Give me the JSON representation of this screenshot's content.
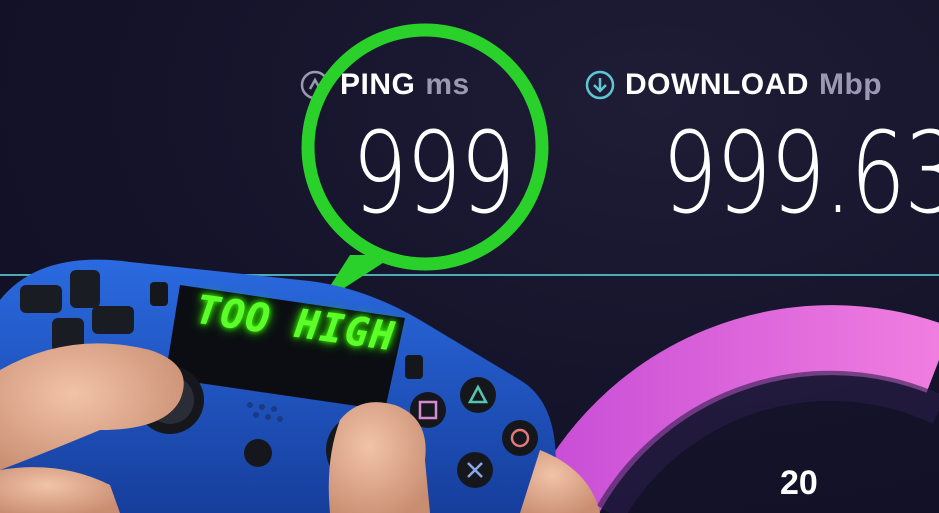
{
  "ping": {
    "label": "PING",
    "unit": "ms",
    "value": "999",
    "icon": "ping-icon"
  },
  "download": {
    "label": "DOWNLOAD",
    "unit": "Mbp",
    "value": "999.63",
    "icon": "download-icon"
  },
  "gauge": {
    "tick_label": "20"
  },
  "controller": {
    "lcd_text": "TOO HIGH"
  },
  "colors": {
    "background": "#141226",
    "highlight_circle": "#2bd12b",
    "gauge_arc": "#e56bd9",
    "lcd_text": "#5cff2a",
    "controller_body": "#1f56c8"
  }
}
